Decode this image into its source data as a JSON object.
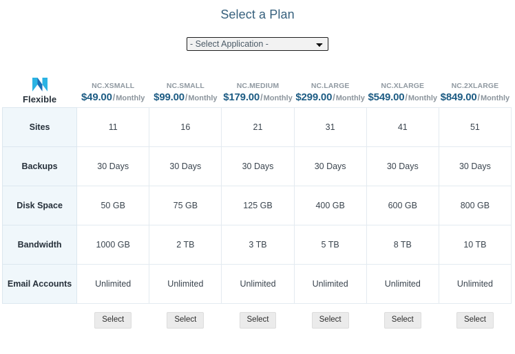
{
  "page": {
    "title": "Select a Plan"
  },
  "application_select": {
    "name": "application-select",
    "selected": "- Select Application -",
    "options": [
      "- Select Application -"
    ]
  },
  "brand": {
    "logo_icon": "nexcess-n-logo-icon",
    "name": "Flexible",
    "logo_color_light": "#2bb3e3",
    "logo_color_dark": "#1a6fb5"
  },
  "theme": {
    "title_color": "#36607d",
    "price_color": "#1d5c84",
    "plan_name_color": "#9099a1",
    "row_label_bg": "#f0f7fb",
    "grid_border": "#e3eaf0",
    "button_bg": "#ebebeb"
  },
  "plans": [
    {
      "name": "NC.XSMALL",
      "price": "$49.00",
      "separator": "/",
      "period": "Monthly",
      "select_label": "Select"
    },
    {
      "name": "NC.SMALL",
      "price": "$99.00",
      "separator": "/",
      "period": "Monthly",
      "select_label": "Select"
    },
    {
      "name": "NC.MEDIUM",
      "price": "$179.00",
      "separator": "/",
      "period": "Monthly",
      "select_label": "Select"
    },
    {
      "name": "NC.LARGE",
      "price": "$299.00",
      "separator": "/",
      "period": "Monthly",
      "select_label": "Select"
    },
    {
      "name": "NC.XLARGE",
      "price": "$549.00",
      "separator": "/",
      "period": "Monthly",
      "select_label": "Select"
    },
    {
      "name": "NC.2XLARGE",
      "price": "$849.00",
      "separator": "/",
      "period": "Monthly",
      "select_label": "Select"
    }
  ],
  "features": [
    {
      "label": "Sites",
      "values": [
        "11",
        "16",
        "21",
        "31",
        "41",
        "51"
      ]
    },
    {
      "label": "Backups",
      "values": [
        "30 Days",
        "30 Days",
        "30 Days",
        "30 Days",
        "30 Days",
        "30 Days"
      ]
    },
    {
      "label": "Disk Space",
      "values": [
        "50 GB",
        "75 GB",
        "125 GB",
        "400 GB",
        "600 GB",
        "800 GB"
      ]
    },
    {
      "label": "Bandwidth",
      "values": [
        "1000 GB",
        "2 TB",
        "3 TB",
        "5 TB",
        "8 TB",
        "10 TB"
      ]
    },
    {
      "label": "Email Accounts",
      "values": [
        "Unlimited",
        "Unlimited",
        "Unlimited",
        "Unlimited",
        "Unlimited",
        "Unlimited"
      ]
    }
  ]
}
